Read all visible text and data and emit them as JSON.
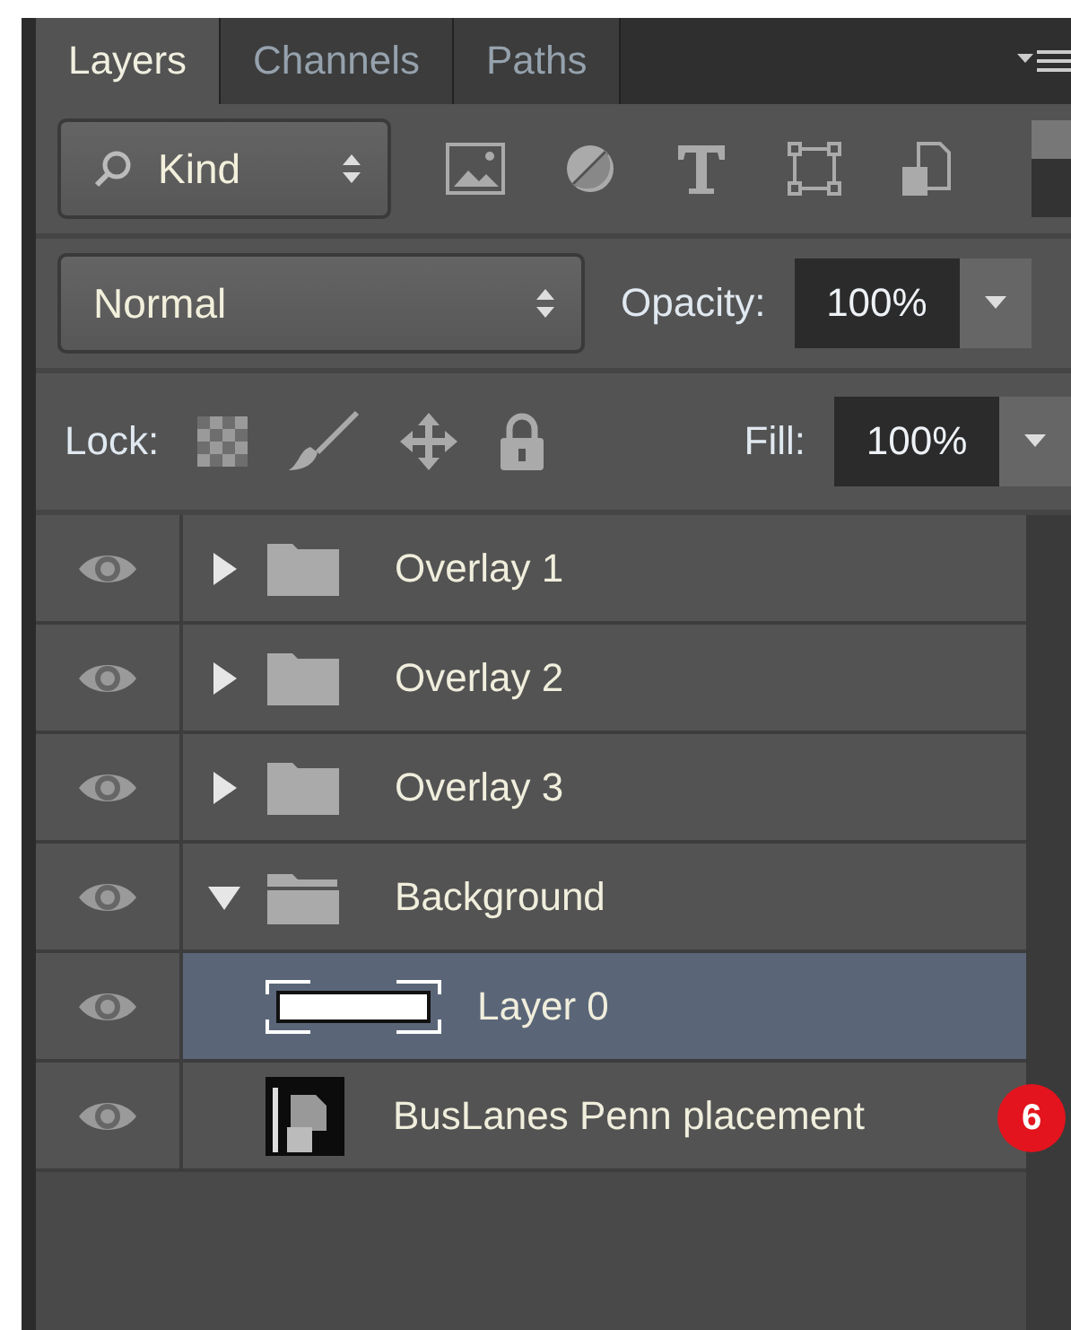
{
  "tabs": [
    {
      "label": "Layers",
      "selected": true
    },
    {
      "label": "Channels",
      "selected": false
    },
    {
      "label": "Paths",
      "selected": false
    }
  ],
  "filter": {
    "value": "Kind"
  },
  "blend_mode": {
    "value": "Normal"
  },
  "opacity": {
    "label": "Opacity:",
    "value": "100%"
  },
  "lock": {
    "label": "Lock:"
  },
  "fill": {
    "label": "Fill:",
    "value": "100%"
  },
  "layers": [
    {
      "name": "Overlay 1",
      "kind": "group",
      "visible": true,
      "expanded": false,
      "selected": false
    },
    {
      "name": "Overlay 2",
      "kind": "group",
      "visible": true,
      "expanded": false,
      "selected": false
    },
    {
      "name": "Overlay 3",
      "kind": "group",
      "visible": true,
      "expanded": false,
      "selected": false
    },
    {
      "name": "Background",
      "kind": "group",
      "visible": true,
      "expanded": true,
      "selected": false,
      "children": [
        {
          "name": "Layer 0",
          "kind": "shape",
          "visible": true,
          "selected": true
        },
        {
          "name": "BusLanes Penn placement",
          "kind": "smart",
          "visible": true,
          "selected": false,
          "badge": "6"
        }
      ]
    }
  ]
}
